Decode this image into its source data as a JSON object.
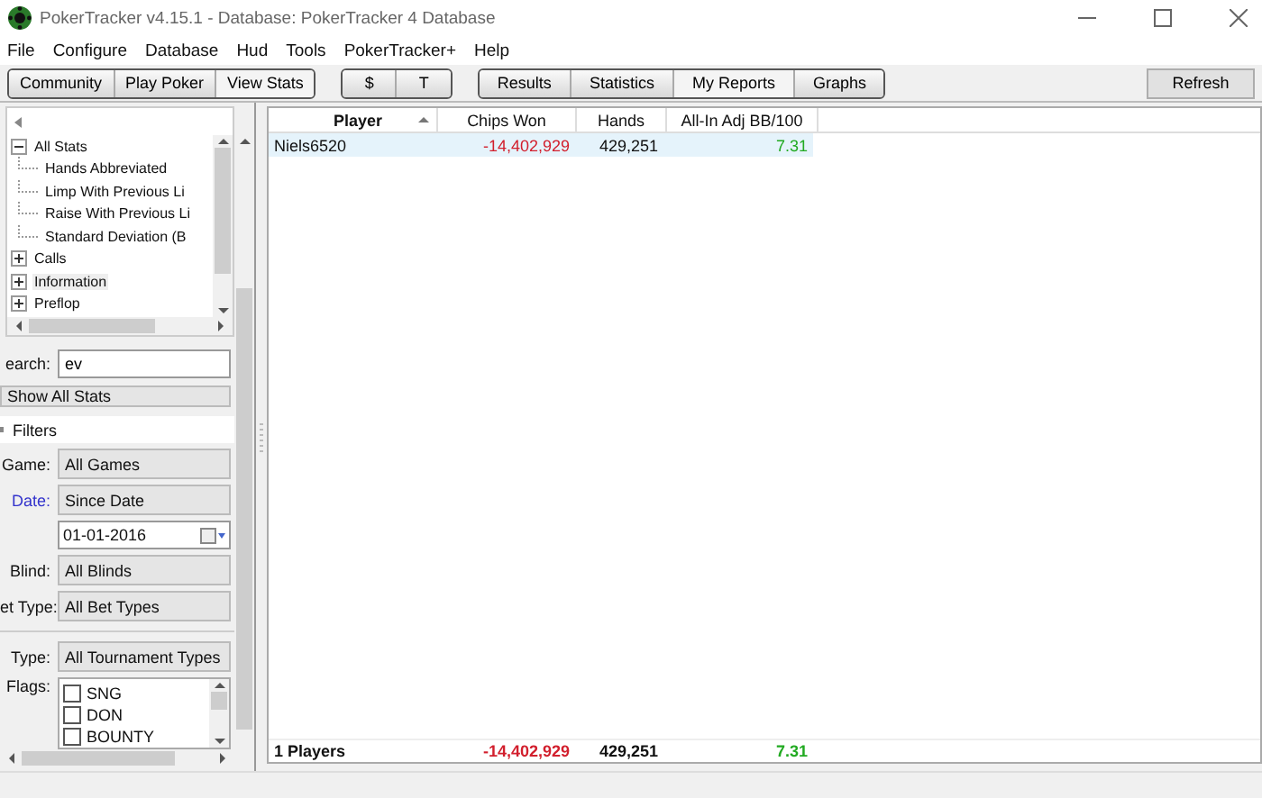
{
  "window": {
    "title": "PokerTracker v4.15.1 - Database: PokerTracker 4 Database"
  },
  "menu": [
    "File",
    "Configure",
    "Database",
    "Hud",
    "Tools",
    "PokerTracker+",
    "Help"
  ],
  "toolbar_groups": [
    {
      "buttons": [
        {
          "label": "Community",
          "selected": false
        },
        {
          "label": "Play Poker",
          "selected": false
        },
        {
          "label": "View Stats",
          "selected": true
        }
      ]
    },
    {
      "buttons": [
        {
          "label": "$",
          "selected": false
        },
        {
          "label": "T",
          "selected": false
        }
      ]
    },
    {
      "buttons": [
        {
          "label": "Results",
          "selected": false
        },
        {
          "label": "Statistics",
          "selected": false
        },
        {
          "label": "My Reports",
          "selected": true
        },
        {
          "label": "Graphs",
          "selected": false
        }
      ]
    }
  ],
  "refresh_button": "Refresh",
  "stat_tree": [
    {
      "label": "All Stats",
      "expanded": true,
      "selected": false,
      "children": [
        {
          "label": "Hands Abbreviated",
          "selected": false
        },
        {
          "label": "Limp With Previous Li",
          "selected": false
        },
        {
          "label": "Raise With Previous Li",
          "selected": false
        },
        {
          "label": "Standard Deviation (B",
          "selected": false
        }
      ]
    },
    {
      "label": "Calls",
      "expanded": false,
      "selected": false
    },
    {
      "label": "Information",
      "expanded": false,
      "selected": true
    },
    {
      "label": "Preflop",
      "expanded": false,
      "selected": false
    }
  ],
  "search": {
    "label": "earch:",
    "value": "ev"
  },
  "stat_filter": "Show All Stats",
  "filters_heading": "Filters",
  "filters": [
    {
      "kind": "select",
      "label": "Game:",
      "value": "All Games",
      "highlighted": false
    },
    {
      "kind": "select",
      "label": "Date:",
      "value": "Since Date",
      "highlighted": true
    },
    {
      "kind": "date",
      "value": "01-01-2016"
    },
    {
      "kind": "select",
      "label": "Blind:",
      "value": "All Blinds",
      "highlighted": false
    },
    {
      "kind": "select",
      "label": "et Type:",
      "value": "All Bet Types",
      "highlighted": false
    },
    {
      "kind": "divider"
    },
    {
      "kind": "select",
      "label": "Type:",
      "value": "All Tournament Types",
      "highlighted": false
    },
    {
      "kind": "checklist",
      "label": "Flags:",
      "items": [
        {
          "label": "SNG",
          "checked": false
        },
        {
          "label": "DON",
          "checked": false
        },
        {
          "label": "BOUNTY",
          "checked": false
        }
      ]
    }
  ],
  "table": {
    "columns": [
      {
        "label": "Player",
        "sorted": true
      },
      {
        "label": "Chips Won",
        "sorted": false
      },
      {
        "label": "Hands",
        "sorted": false
      },
      {
        "label": "All-In Adj BB/100",
        "sorted": false
      }
    ],
    "rows": [
      {
        "selected": true,
        "cells": [
          {
            "text": "Niels6520",
            "kind": "plain"
          },
          {
            "text": "-14,402,929",
            "kind": "negative"
          },
          {
            "text": "429,251",
            "kind": "plain"
          },
          {
            "text": "7.31",
            "kind": "positive"
          }
        ]
      }
    ],
    "totals": [
      {
        "text": "1 Players",
        "kind": "plain"
      },
      {
        "text": "-14,402,929",
        "kind": "negative"
      },
      {
        "text": "429,251",
        "kind": "plain"
      },
      {
        "text": "7.31",
        "kind": "positive"
      }
    ]
  }
}
